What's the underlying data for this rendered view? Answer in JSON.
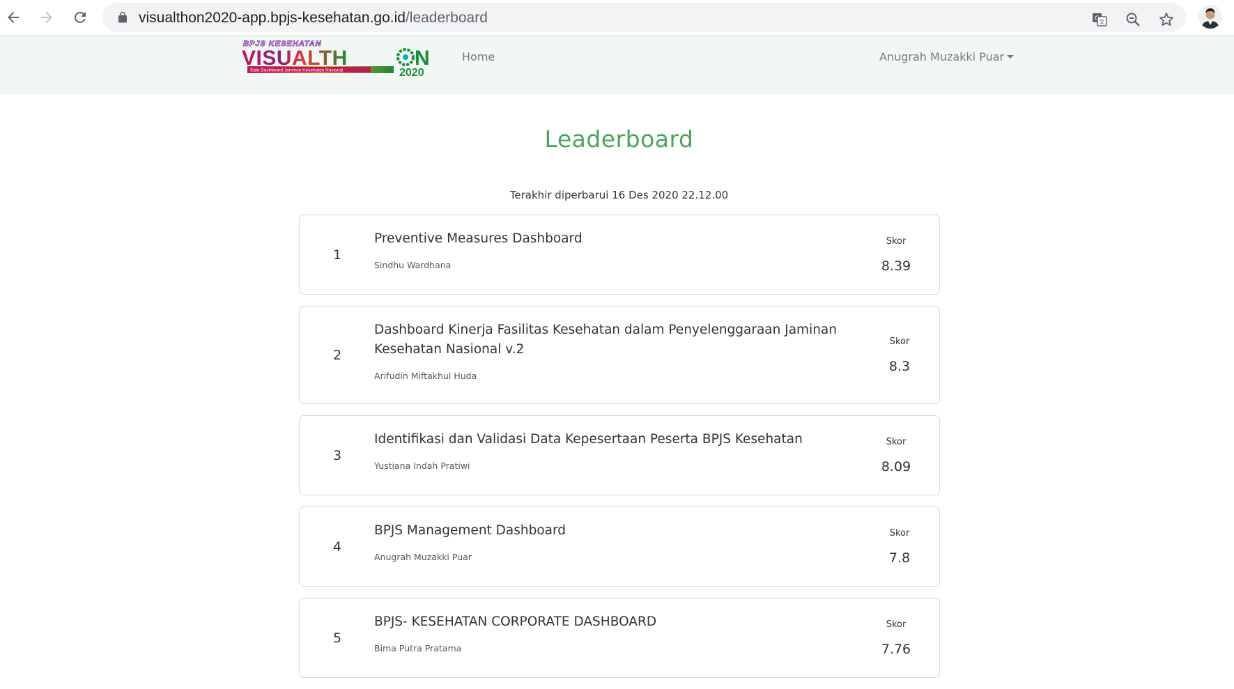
{
  "browser": {
    "url_host": "visualthon2020-app.bpjs-kesehatan.go.id",
    "url_path": "/leaderboard"
  },
  "nav": {
    "logo_top": "BPJS KESEHATAN",
    "logo_main_a": "VISUALTH",
    "logo_main_b": "N",
    "logo_tagline": "Satu Dashboard Jaminan Kesehatan Nasional",
    "logo_year": "2020",
    "home_label": "Home",
    "user_label": "Anugrah Muzakki Puar"
  },
  "page": {
    "title": "Leaderboard",
    "updated": "Terakhir diperbarui 16 Des 2020 22.12.00"
  },
  "leaderboard": [
    {
      "rank": "1",
      "title": "Preventive Measures Dashboard",
      "author": "Sindhu Wardhana",
      "score_label": "Skor",
      "score": "8.39"
    },
    {
      "rank": "2",
      "title": "Dashboard Kinerja Fasilitas Kesehatan dalam Penyelenggaraan Jaminan Kesehatan Nasional v.2",
      "author": "Arifudin Miftakhul Huda",
      "score_label": "Skor",
      "score": "8.3"
    },
    {
      "rank": "3",
      "title": "Identifikasi dan Validasi Data Kepesertaan Peserta BPJS Kesehatan",
      "author": "Yustiana Indah Pratiwi",
      "score_label": "Skor",
      "score": "8.09"
    },
    {
      "rank": "4",
      "title": "BPJS Management Dashboard",
      "author": "Anugrah Muzakki Puar",
      "score_label": "Skor",
      "score": "7.8"
    },
    {
      "rank": "5",
      "title": "BPJS- KESEHATAN CORPORATE DASHBOARD",
      "author": "Bima Putra Pratama",
      "score_label": "Skor",
      "score": "7.76"
    }
  ]
}
